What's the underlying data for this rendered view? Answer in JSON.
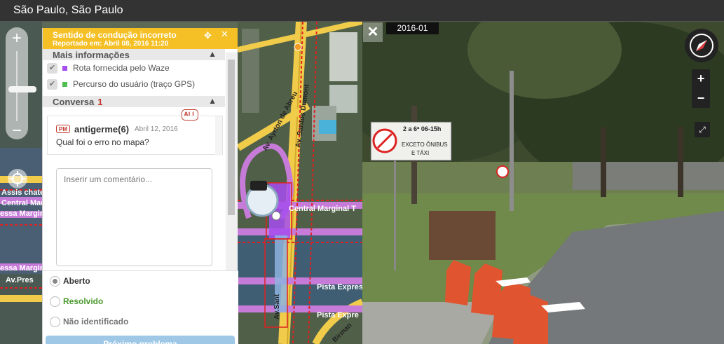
{
  "window": {
    "title": "São Paulo, São Paulo"
  },
  "map": {
    "zoom_in": "+",
    "zoom_out": "−",
    "labels": {
      "assis_chateaubriand": "Assis chate",
      "central_marginal_left1": "Central Margina",
      "margina_left": "essa Margin",
      "margina_left2": "essa Margin",
      "av_pres": "Av.Pres",
      "av_ayrton": "Av. Ayrton de Abreu",
      "av_santos_dumont": "Av. Santos Dumont",
      "central_marginal_right": "Central Marginal T",
      "pista_expres": "Pista Expres",
      "pista_expre2": "Pista Expre",
      "av_sant": "Av.Sant",
      "birman": "Birman"
    }
  },
  "panel": {
    "title": "Sentido de condução incorreto",
    "reported": "Reportado em: Abril 08, 2016 11:20",
    "more_info": "Mais informações",
    "route_waze": "Rota fornecida pelo Waze",
    "user_route": "Percurso do usuário (traço GPS)",
    "conversation": "Conversa",
    "conversation_count": "1",
    "all_badge": "ALL",
    "pm_badge": "PM",
    "comment_user": "antigerme(6)",
    "comment_date": "Abril 12, 2016",
    "comment_text": "Qual foi o erro no mapa?",
    "comment_placeholder": "Inserir um comentário...",
    "status_open": "Aberto",
    "status_resolved": "Resolvido",
    "status_unidentified": "Não identificado",
    "next_button": "Próximo problema",
    "colors": {
      "header": "#f5c026",
      "route_waze": "#a64df0",
      "user_route": "#4fbf4f",
      "resolved": "#4a9a2e"
    }
  },
  "streetview": {
    "date": "2016-01",
    "zoom_in": "+",
    "zoom_out": "−",
    "sign_lines": [
      "2 a 6ª 06-15h",
      "EXCETO ÔNIBUS",
      "E TÁXI"
    ]
  }
}
